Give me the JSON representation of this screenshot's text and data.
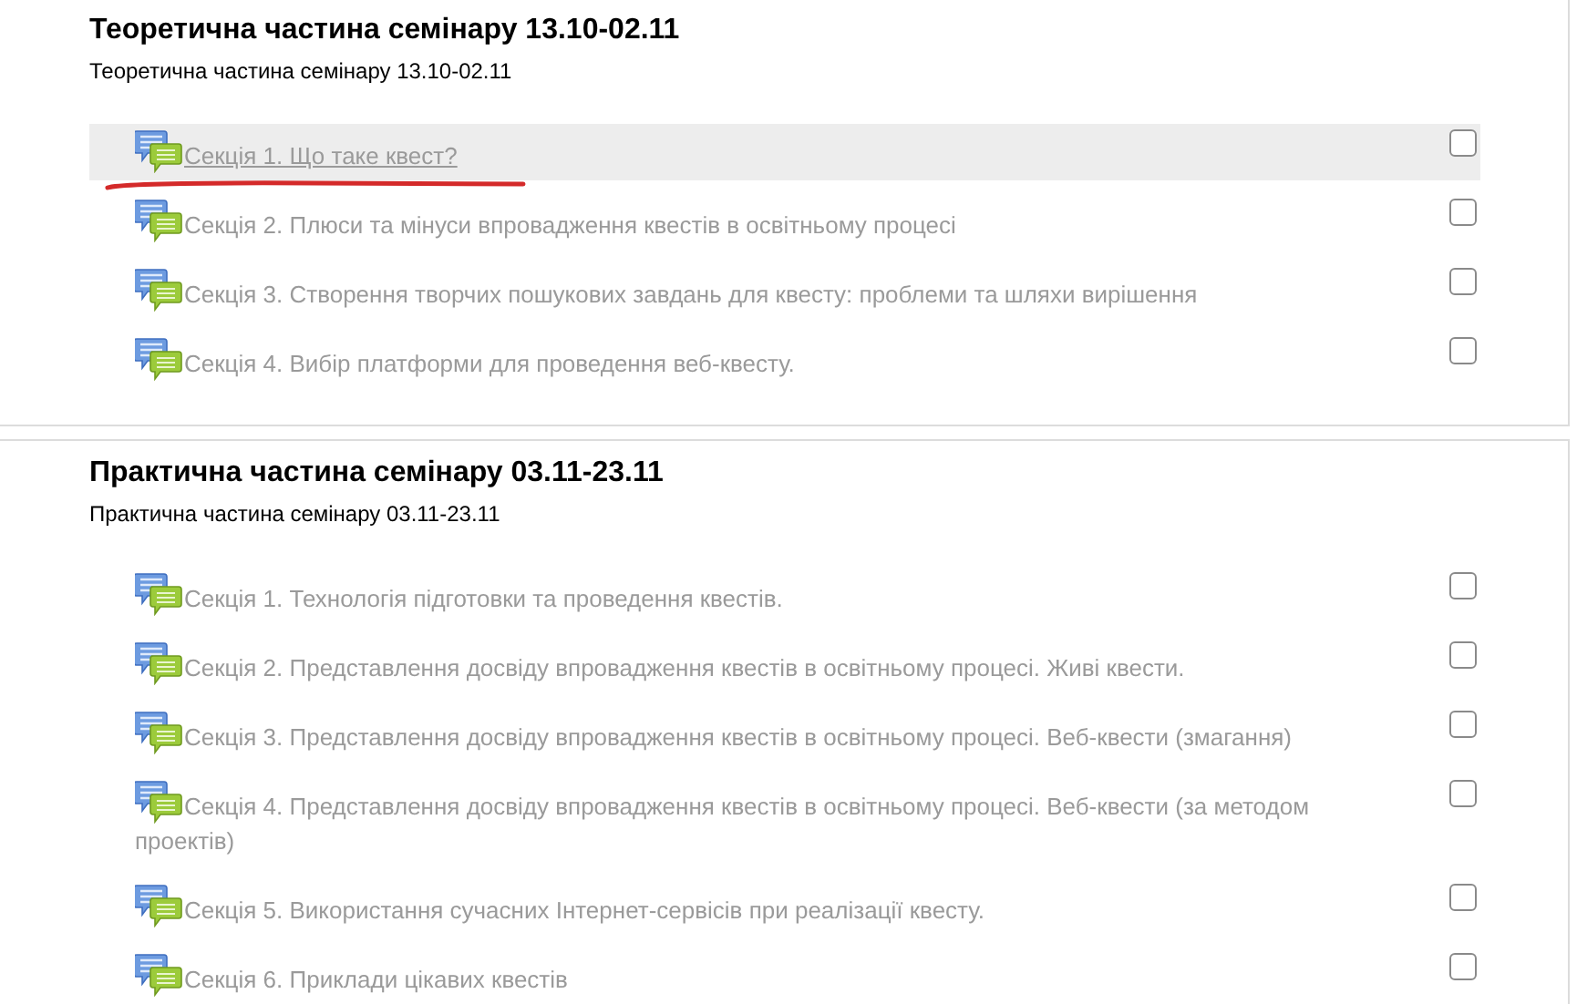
{
  "sections": [
    {
      "title": "Теоретична частина семінару 13.10-02.11",
      "summary": "Теоретична частина семінару 13.10-02.11",
      "activities": [
        {
          "label": "Секція 1. Що таке квест?",
          "hovered": true,
          "underlined": true,
          "checked": false
        },
        {
          "label": "Секція 2. Плюси та мінуси впровадження квестів в освітньому процесі",
          "hovered": false,
          "underlined": false,
          "checked": false
        },
        {
          "label": "Секція 3. Створення творчих пошукових завдань для квесту: проблеми та шляхи вирішення",
          "hovered": false,
          "underlined": false,
          "checked": false
        },
        {
          "label": "Секція 4. Вибір платформи для проведення веб-квесту.",
          "hovered": false,
          "underlined": false,
          "checked": false
        }
      ]
    },
    {
      "title": "Практична частина семінару 03.11-23.11",
      "summary": "Практична частина семінару 03.11-23.11",
      "activities": [
        {
          "label": "Секція 1. Технологія підготовки та проведення квестів.",
          "hovered": false,
          "underlined": false,
          "checked": false
        },
        {
          "label": "Секція 2. Представлення досвіду впровадження квестів в освітньому процесі. Живі квести.",
          "hovered": false,
          "underlined": false,
          "checked": false
        },
        {
          "label": "Секція 3. Представлення досвіду впровадження квестів в освітньому процесі. Веб-квести (змагання)",
          "hovered": false,
          "underlined": false,
          "checked": false
        },
        {
          "label": "Секція 4. Представлення досвіду впровадження квестів в освітньому процесі. Веб-квести (за методом проектів)",
          "hovered": false,
          "underlined": false,
          "checked": false
        },
        {
          "label": "Секція 5. Використання сучасних Інтернет-сервісів при реалізації квесту.",
          "hovered": false,
          "underlined": false,
          "checked": false
        },
        {
          "label": "Секція 6. Приклади цікавих квестів",
          "hovered": false,
          "underlined": false,
          "checked": false
        }
      ]
    }
  ]
}
